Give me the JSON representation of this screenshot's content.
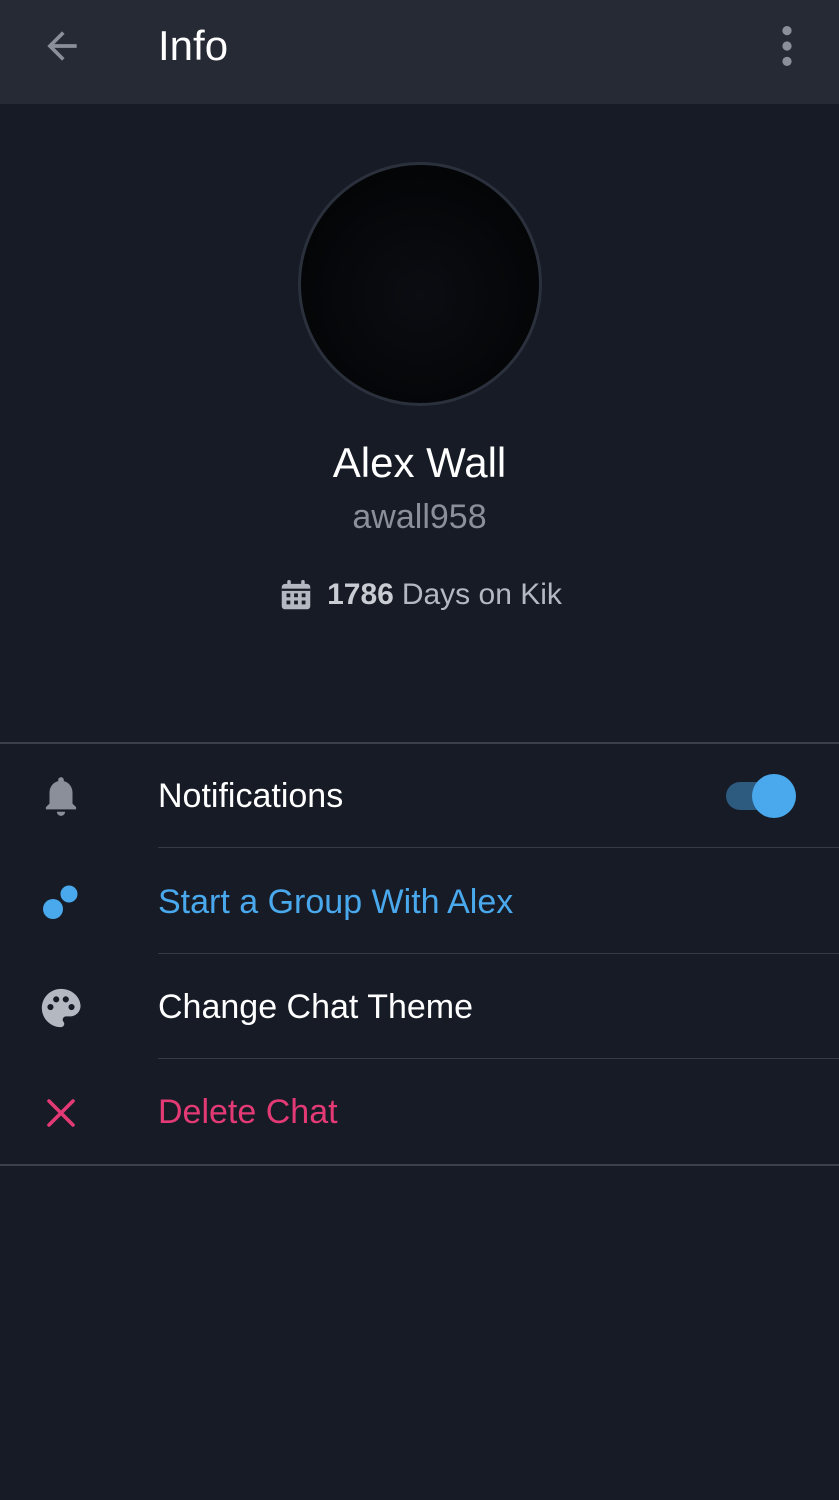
{
  "header": {
    "title": "Info",
    "back_icon": "arrow-left-icon",
    "more_icon": "more-vertical-icon"
  },
  "profile": {
    "display_name": "Alex Wall",
    "username": "awall958",
    "days_count": "1786",
    "days_suffix": "Days on Kik",
    "calendar_icon": "calendar-icon"
  },
  "menu": {
    "notifications": {
      "label": "Notifications",
      "icon": "bell-icon",
      "enabled": true
    },
    "start_group": {
      "label": "Start a Group With Alex",
      "icon": "group-icon"
    },
    "change_theme": {
      "label": "Change Chat Theme",
      "icon": "palette-icon"
    },
    "delete_chat": {
      "label": "Delete Chat",
      "icon": "close-icon"
    }
  },
  "colors": {
    "background": "#161b26",
    "app_bar": "#252a35",
    "accent_blue": "#4aa8ec",
    "danger_pink": "#e33a75",
    "text_primary": "#ffffff",
    "text_secondary": "#8a8f99"
  }
}
